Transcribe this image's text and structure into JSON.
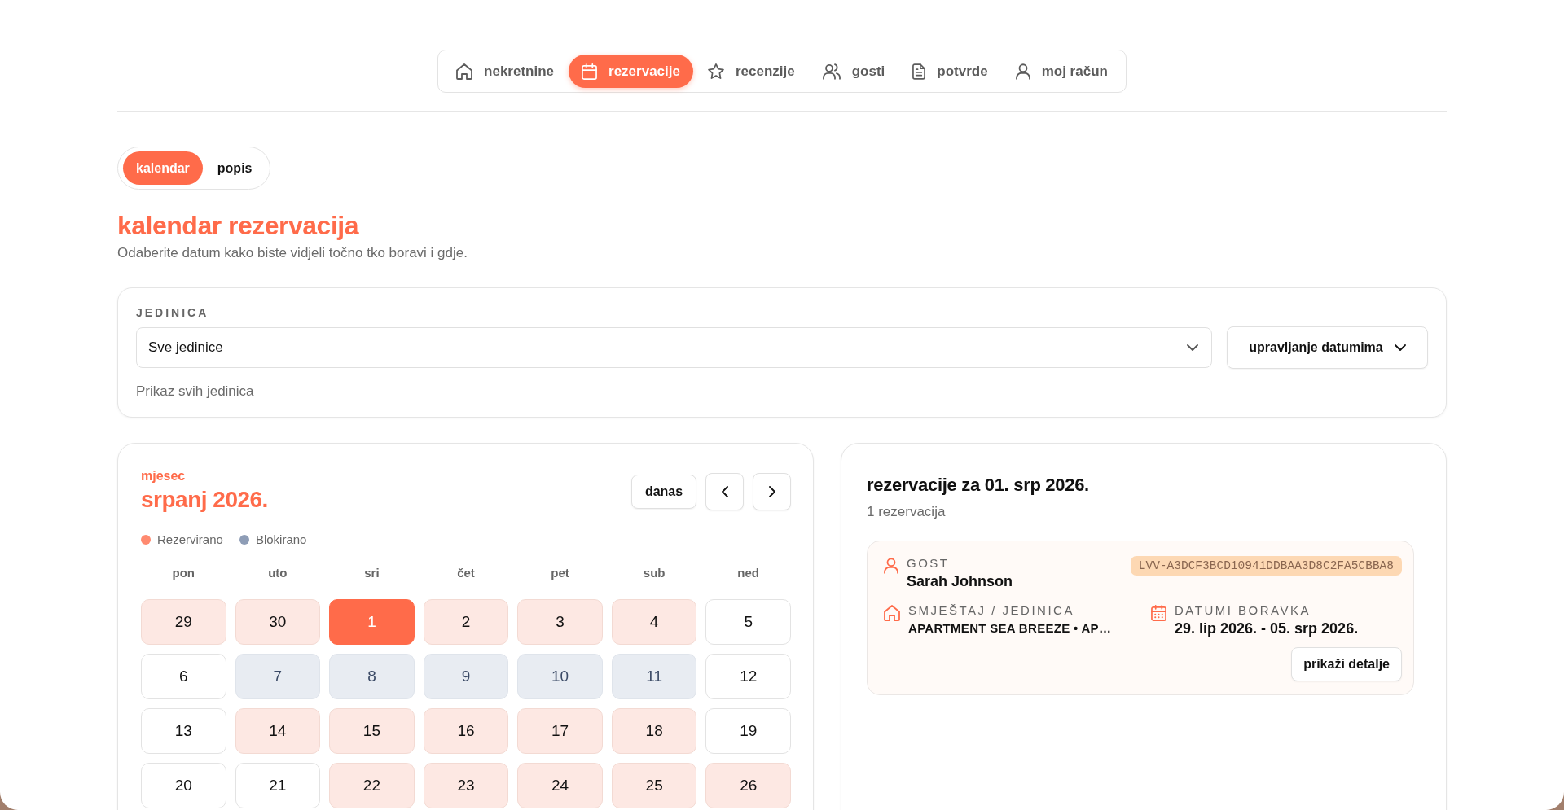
{
  "nav": [
    {
      "label": "nekretnine",
      "selected": false
    },
    {
      "label": "rezervacije",
      "selected": true
    },
    {
      "label": "recenzije",
      "selected": false
    },
    {
      "label": "gosti",
      "selected": false
    },
    {
      "label": "potvrde",
      "selected": false
    },
    {
      "label": "moj račun",
      "selected": false
    }
  ],
  "view_tabs": [
    {
      "label": "kalendar",
      "selected": true
    },
    {
      "label": "popis",
      "selected": false
    }
  ],
  "page": {
    "title": "kalendar rezervacija",
    "subtitle": "Odaberite datum kako biste vidjeli točno tko boravi i gdje."
  },
  "unit_filter": {
    "label": "JEDINICA",
    "value": "Sve jedinice",
    "hint": "Prikaz svih jedinica",
    "manage_button": "upravljanje datumima"
  },
  "calendar": {
    "caption": "mjesec",
    "month": "srpanj 2026.",
    "today_button": "danas",
    "legend": [
      {
        "label": "Rezervirano",
        "color": "#ff8a70"
      },
      {
        "label": "Blokirano",
        "color": "#8e9db6"
      }
    ],
    "weekdays": [
      "pon",
      "uto",
      "sri",
      "čet",
      "pet",
      "sub",
      "ned"
    ],
    "days": [
      {
        "label": "29",
        "kind": "reserved",
        "selected": false
      },
      {
        "label": "30",
        "kind": "reserved",
        "selected": false
      },
      {
        "label": "1",
        "kind": "reserved",
        "selected": true
      },
      {
        "label": "2",
        "kind": "reserved",
        "selected": false
      },
      {
        "label": "3",
        "kind": "reserved",
        "selected": false
      },
      {
        "label": "4",
        "kind": "reserved",
        "selected": false
      },
      {
        "label": "5",
        "kind": "free",
        "selected": false
      },
      {
        "label": "6",
        "kind": "free",
        "selected": false
      },
      {
        "label": "7",
        "kind": "blocked",
        "selected": false
      },
      {
        "label": "8",
        "kind": "blocked",
        "selected": false
      },
      {
        "label": "9",
        "kind": "blocked",
        "selected": false
      },
      {
        "label": "10",
        "kind": "blocked",
        "selected": false
      },
      {
        "label": "11",
        "kind": "blocked",
        "selected": false
      },
      {
        "label": "12",
        "kind": "free",
        "selected": false
      },
      {
        "label": "13",
        "kind": "free",
        "selected": false
      },
      {
        "label": "14",
        "kind": "reserved",
        "selected": false
      },
      {
        "label": "15",
        "kind": "reserved",
        "selected": false
      },
      {
        "label": "16",
        "kind": "reserved",
        "selected": false
      },
      {
        "label": "17",
        "kind": "reserved",
        "selected": false
      },
      {
        "label": "18",
        "kind": "reserved",
        "selected": false
      },
      {
        "label": "19",
        "kind": "free",
        "selected": false
      },
      {
        "label": "20",
        "kind": "free",
        "selected": false
      },
      {
        "label": "21",
        "kind": "free",
        "selected": false
      },
      {
        "label": "22",
        "kind": "reserved",
        "selected": false
      },
      {
        "label": "23",
        "kind": "reserved",
        "selected": false
      },
      {
        "label": "24",
        "kind": "reserved",
        "selected": false
      },
      {
        "label": "25",
        "kind": "reserved",
        "selected": false
      },
      {
        "label": "26",
        "kind": "reserved",
        "selected": false
      }
    ]
  },
  "reservations_panel": {
    "title": "rezervacije za 01. srp 2026.",
    "count": "1 rezervacija",
    "reservations": [
      {
        "guest_label": "GOST",
        "guest": "Sarah Johnson",
        "code": "LVV-A3DCF3BCD10941DDBAA3D8C2FA5CBBA8",
        "unit_label": "SMJEŠTAJ / JEDINICA",
        "unit": "APARTMENT SEA BREEZE • AP…",
        "dates_label": "DATUMI BORAVKA",
        "dates": "29. lip 2026. - 05. srp 2026.",
        "details_button": "prikaži detalje"
      }
    ]
  }
}
